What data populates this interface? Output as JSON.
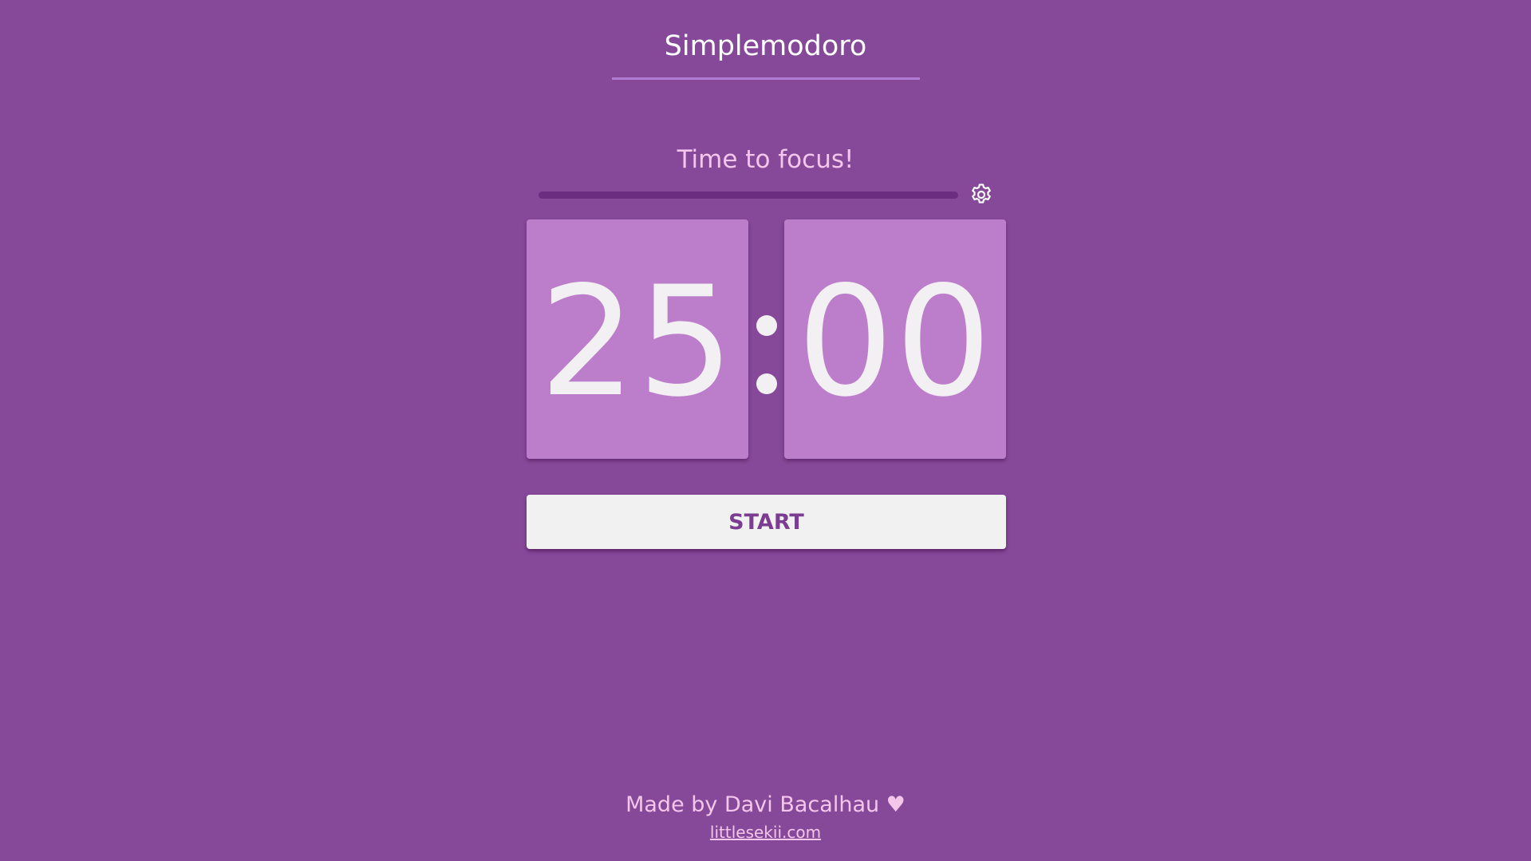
{
  "app": {
    "title": "Simplemodoro",
    "colors": {
      "background": "#864899",
      "card": "#bc7ecb",
      "accent_text": "#f3c6ea",
      "button_bg": "#f2f1f1",
      "button_text": "#7a3d91"
    }
  },
  "timer": {
    "status": "Time to focus!",
    "progress": 0,
    "minutes": "25",
    "seconds": "00",
    "separator_icon": "colon-icon",
    "settings_icon": "gear-icon"
  },
  "controls": {
    "start_label": "START"
  },
  "footer": {
    "credit": "Made by Davi Bacalhau ♥",
    "link_text": "littlesekii.com"
  }
}
